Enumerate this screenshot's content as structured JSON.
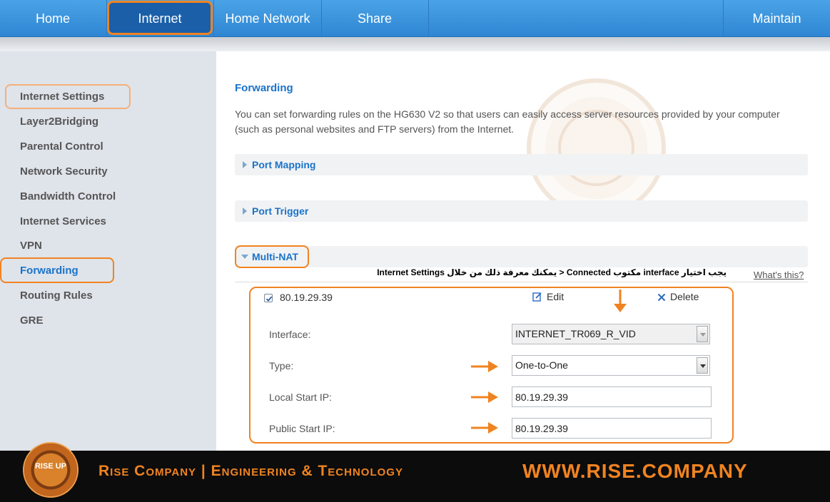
{
  "nav": {
    "home": "Home",
    "internet": "Internet",
    "home_network": "Home Network",
    "share": "Share",
    "maintain": "Maintain"
  },
  "sidebar": {
    "items": [
      {
        "label": "Internet Settings"
      },
      {
        "label": "Layer2Bridging"
      },
      {
        "label": "Parental Control"
      },
      {
        "label": "Network Security"
      },
      {
        "label": "Bandwidth Control"
      },
      {
        "label": "Internet Services"
      },
      {
        "label": "VPN"
      },
      {
        "label": "Forwarding"
      },
      {
        "label": "Routing Rules"
      },
      {
        "label": "GRE"
      }
    ],
    "active": "Forwarding"
  },
  "main": {
    "title": "Forwarding",
    "description": "You can set forwarding rules on the HG630 V2 so that users can easily access server resources provided by your computer (such as personal websites and FTP servers) from the Internet.",
    "sections": {
      "port_mapping": "Port Mapping",
      "port_trigger": "Port Trigger",
      "multi_nat": "Multi-NAT"
    },
    "whats_this": "What's this?",
    "annotation_note": "يجب اختيار interface مكتوب Connected < يمكنك معرفة ذلك من خلال Internet Settings",
    "rule": {
      "checked": true,
      "ip": "80.19.29.39",
      "edit_label": "Edit",
      "delete_label": "Delete",
      "interface_label": "Interface:",
      "interface_value": "INTERNET_TR069_R_VID",
      "type_label": "Type:",
      "type_value": "One-to-One",
      "local_start_ip_label": "Local Start IP:",
      "local_start_ip_value": "80.19.29.39",
      "public_start_ip_label": "Public Start IP:",
      "public_start_ip_value": "80.19.29.39"
    }
  },
  "footer": {
    "logo_text": "RISE UP",
    "company": "Rise Company | Engineering & Technology",
    "url": "WWW.RISE.COMPANY"
  },
  "colors": {
    "accent": "#f08321",
    "nav_blue": "#2f86d3",
    "link_blue": "#1a73c9",
    "sidebar_bg": "#dfe3ea"
  }
}
